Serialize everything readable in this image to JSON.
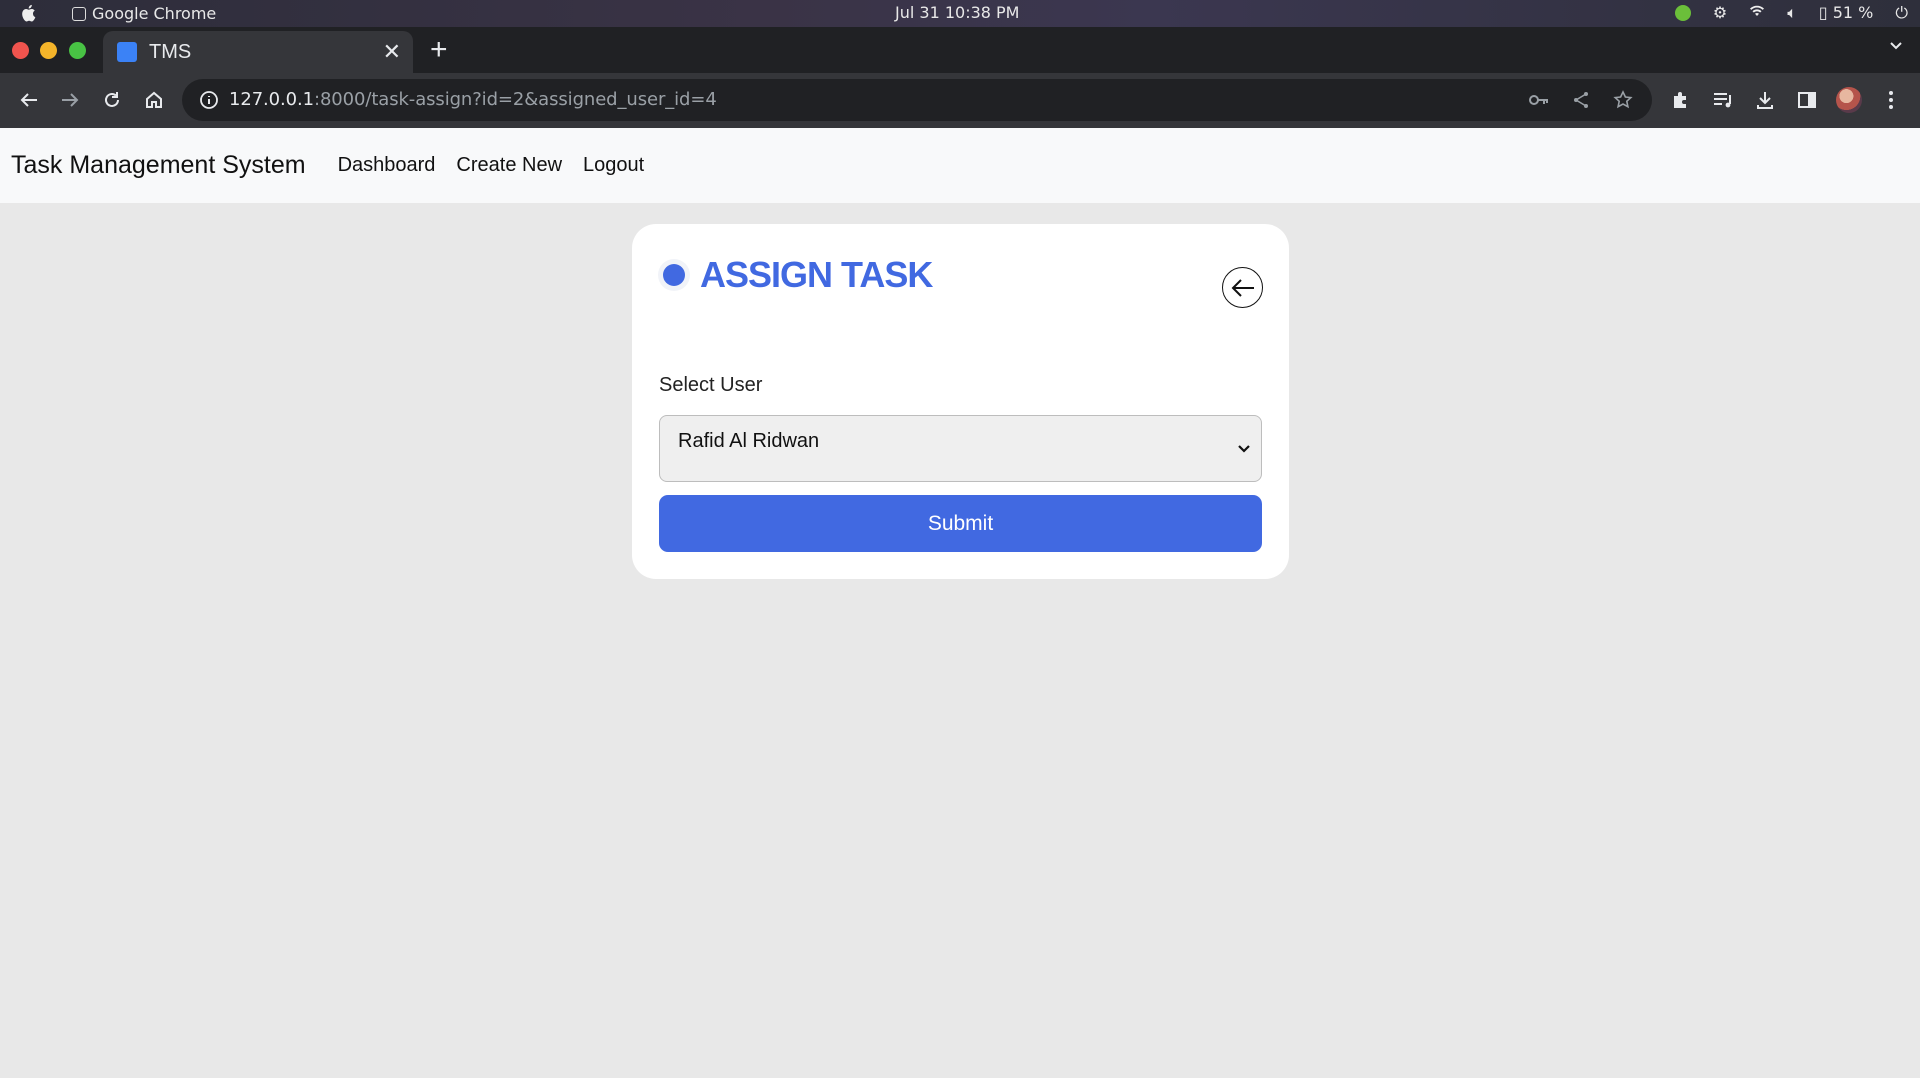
{
  "os": {
    "app_name": "Google Chrome",
    "clock": "Jul 31  10:38 PM",
    "battery": "51 %"
  },
  "browser": {
    "tab_title": "TMS",
    "url_host": "127.0.0.1",
    "url_rest": ":8000/task-assign?id=2&assigned_user_id=4"
  },
  "navbar": {
    "brand": "Task Management System",
    "links": [
      "Dashboard",
      "Create New",
      "Logout"
    ]
  },
  "card": {
    "title": "ASSIGN TASK",
    "field_label": "Select User",
    "selected_user": "Rafid Al Ridwan",
    "submit_label": "Submit"
  },
  "colors": {
    "accent": "#4169e1",
    "page_bg": "#e8e8e8",
    "navbar_bg": "#f8f9fa"
  }
}
